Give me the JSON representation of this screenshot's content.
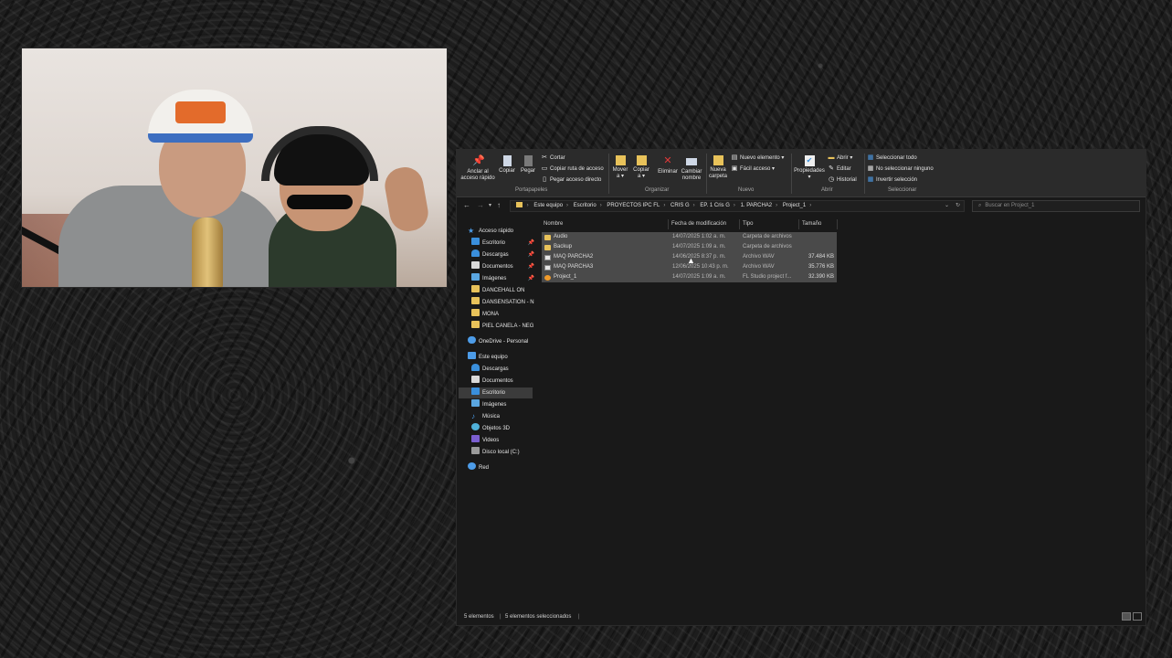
{
  "ribbon": {
    "pin_label": "Anclar al\nacceso rápido",
    "copy_label": "Copiar",
    "paste_label": "Pegar",
    "cut_label": "Cortar",
    "copy_path_label": "Copiar ruta de acceso",
    "paste_shortcut_label": "Pegar acceso directo",
    "group_clipboard": "Portapapeles",
    "move_label": "Mover\na ▾",
    "copy_to_label": "Copiar\na ▾",
    "delete_label": "Eliminar",
    "rename_label": "Cambiar\nnombre",
    "group_organize": "Organizar",
    "new_folder_label": "Nueva\ncarpeta",
    "new_item_label": "Nuevo elemento ▾",
    "easy_access_label": "Fácil acceso ▾",
    "group_new": "Nuevo",
    "properties_label": "Propiedades\n▾",
    "open_label": "Abrir ▾",
    "edit_label": "Editar",
    "history_label": "Historial",
    "group_open": "Abrir",
    "select_all_label": "Seleccionar todo",
    "select_none_label": "No seleccionar ninguno",
    "invert_selection_label": "Invertir selección",
    "group_select": "Seleccionar"
  },
  "address": {
    "crumbs": [
      "Este equipo",
      "Escritorio",
      "PROYECTOS IPC FL",
      "CRIS G",
      "EP. 1 Cris G",
      "1. PARCHA2",
      "Project_1"
    ],
    "search_placeholder": "Buscar en Project_1"
  },
  "nav_pane": {
    "quick_access": "Acceso rápido",
    "quick_items": [
      "Escritorio",
      "Descargas",
      "Documentos",
      "Imágenes",
      "DANCEHALL ON",
      "DANSENSATION - N",
      "MONA",
      "PIEL CANELA - NEG"
    ],
    "onedrive": "OneDrive - Personal",
    "this_pc": "Este equipo",
    "pc_items": [
      "Descargas",
      "Documentos",
      "Escritorio",
      "Imágenes",
      "Música",
      "Objetos 3D",
      "Videos",
      "Disco local (C:)"
    ],
    "network": "Red"
  },
  "columns": {
    "name": "Nombre",
    "date": "Fecha de modificación",
    "type": "Tipo",
    "size": "Tamaño"
  },
  "files": [
    {
      "name": "Audio",
      "date": "14/07/2025 1:02 a. m.",
      "type": "Carpeta de archivos",
      "size": ""
    },
    {
      "name": "Backup",
      "date": "14/07/2025 1:09 a. m.",
      "type": "Carpeta de archivos",
      "size": ""
    },
    {
      "name": "MAQ PARCHA2",
      "date": "14/06/2025 8:37 p. m.",
      "type": "Archivo WAV",
      "size": "37.484 KB"
    },
    {
      "name": "MAQ PARCHA3",
      "date": "12/06/2025 10:43 p. m.",
      "type": "Archivo WAV",
      "size": "35.776 KB"
    },
    {
      "name": "Project_1",
      "date": "14/07/2025 1:09 a. m.",
      "type": "FL Studio project f...",
      "size": "32.390 KB"
    }
  ],
  "status": {
    "count": "5 elementos",
    "selected": "5 elementos seleccionados"
  }
}
